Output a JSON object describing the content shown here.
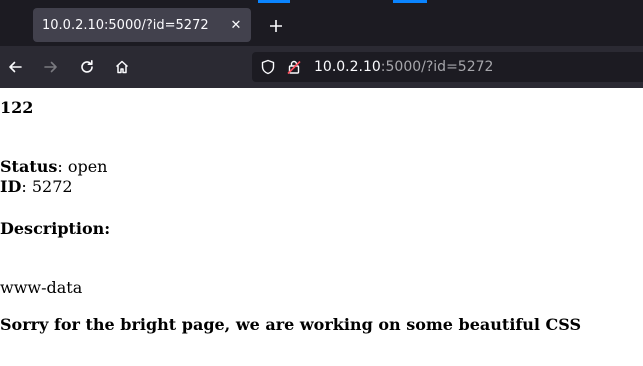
{
  "browser": {
    "tab_title": "10.0.2.10:5000/?id=5272",
    "url_host": "10.0.2.10",
    "url_path": ":5000/?id=5272"
  },
  "page": {
    "heading": "122",
    "status_label": "Status",
    "status_value": ": open",
    "id_label": "ID",
    "id_value": ": 5272",
    "description_label": "Description:",
    "output": "www-data",
    "footer_note": "Sorry for the bright page, we are working on some beautiful CSS"
  }
}
